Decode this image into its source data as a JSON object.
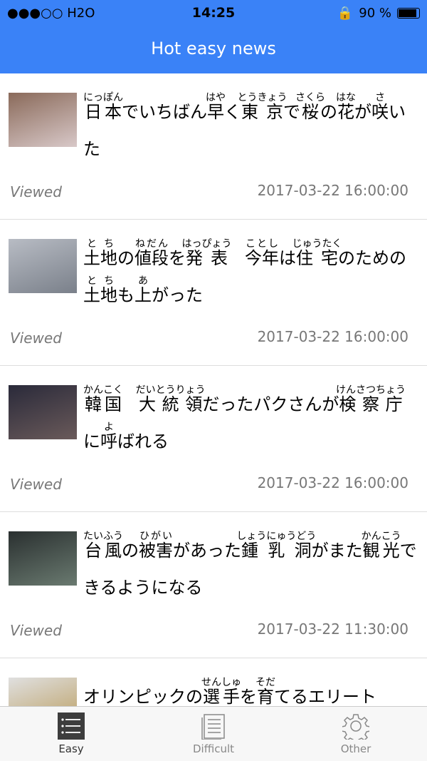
{
  "status": {
    "carrier": "●●●○○ H2O",
    "time": "14:25",
    "battery": "90 %",
    "battery_level": 0.9
  },
  "nav": {
    "title": "Hot easy news"
  },
  "items": [
    {
      "title": [
        [
          "日本",
          "にっぽん"
        ],
        [
          "でいちばん",
          ""
        ],
        [
          "早",
          "はや"
        ],
        [
          "く",
          ""
        ],
        [
          "東京",
          "とうきょう"
        ],
        [
          "で",
          ""
        ],
        [
          "桜",
          "さくら"
        ],
        [
          "の",
          ""
        ],
        [
          "花",
          "はな"
        ],
        [
          "が",
          ""
        ],
        [
          "咲",
          "さ"
        ],
        [
          "いた",
          ""
        ]
      ],
      "status": "Viewed",
      "date": "2017-03-22 16:00:00",
      "thumb": [
        "#8a6a5a",
        "#d8c8c8"
      ]
    },
    {
      "title": [
        [
          "土地",
          "とち"
        ],
        [
          "の",
          ""
        ],
        [
          "値段",
          "ねだん"
        ],
        [
          "を",
          ""
        ],
        [
          "発表",
          "はっぴょう"
        ],
        [
          "　",
          ""
        ],
        [
          "今年",
          "ことし"
        ],
        [
          "は",
          ""
        ],
        [
          "住宅",
          "じゅうたく"
        ],
        [
          "のための",
          ""
        ],
        [
          "土地",
          "とち"
        ],
        [
          "も",
          ""
        ],
        [
          "上",
          "あ"
        ],
        [
          "がった",
          ""
        ]
      ],
      "status": "Viewed",
      "date": "2017-03-22 16:00:00",
      "thumb": [
        "#b8bcc4",
        "#7a808a"
      ]
    },
    {
      "title": [
        [
          "韓国",
          "かんこく"
        ],
        [
          "　",
          ""
        ],
        [
          "大統領",
          "だいとうりょう"
        ],
        [
          "だったパクさんが",
          ""
        ],
        [
          "検察庁",
          "けんさつちょう"
        ],
        [
          "に",
          ""
        ],
        [
          "呼",
          "よ"
        ],
        [
          "ばれる",
          ""
        ]
      ],
      "status": "Viewed",
      "date": "2017-03-22 16:00:00",
      "thumb": [
        "#2a2a3a",
        "#6a5a5a"
      ]
    },
    {
      "title": [
        [
          "台風",
          "たいふう"
        ],
        [
          "の",
          ""
        ],
        [
          "被害",
          "ひがい"
        ],
        [
          "があった",
          ""
        ],
        [
          "鍾乳洞",
          "しょうにゅうどう"
        ],
        [
          "がまた",
          ""
        ],
        [
          "観光",
          "かんこう"
        ],
        [
          "できるようになる",
          ""
        ]
      ],
      "status": "Viewed",
      "date": "2017-03-22 11:30:00",
      "thumb": [
        "#2a3030",
        "#6a7a70"
      ]
    },
    {
      "title": [
        [
          "オリンピックの",
          ""
        ],
        [
          "選手",
          "せんしゅ"
        ],
        [
          "を",
          ""
        ],
        [
          "育",
          "そだ"
        ],
        [
          "てるエリート",
          ""
        ]
      ],
      "status": "",
      "date": "",
      "thumb": [
        "#e0e0e0",
        "#b89a5a"
      ]
    }
  ],
  "tabs": [
    {
      "label": "Easy",
      "icon": "list-icon",
      "active": true
    },
    {
      "label": "Difficult",
      "icon": "document-icon",
      "active": false
    },
    {
      "label": "Other",
      "icon": "gear-icon",
      "active": false
    }
  ]
}
